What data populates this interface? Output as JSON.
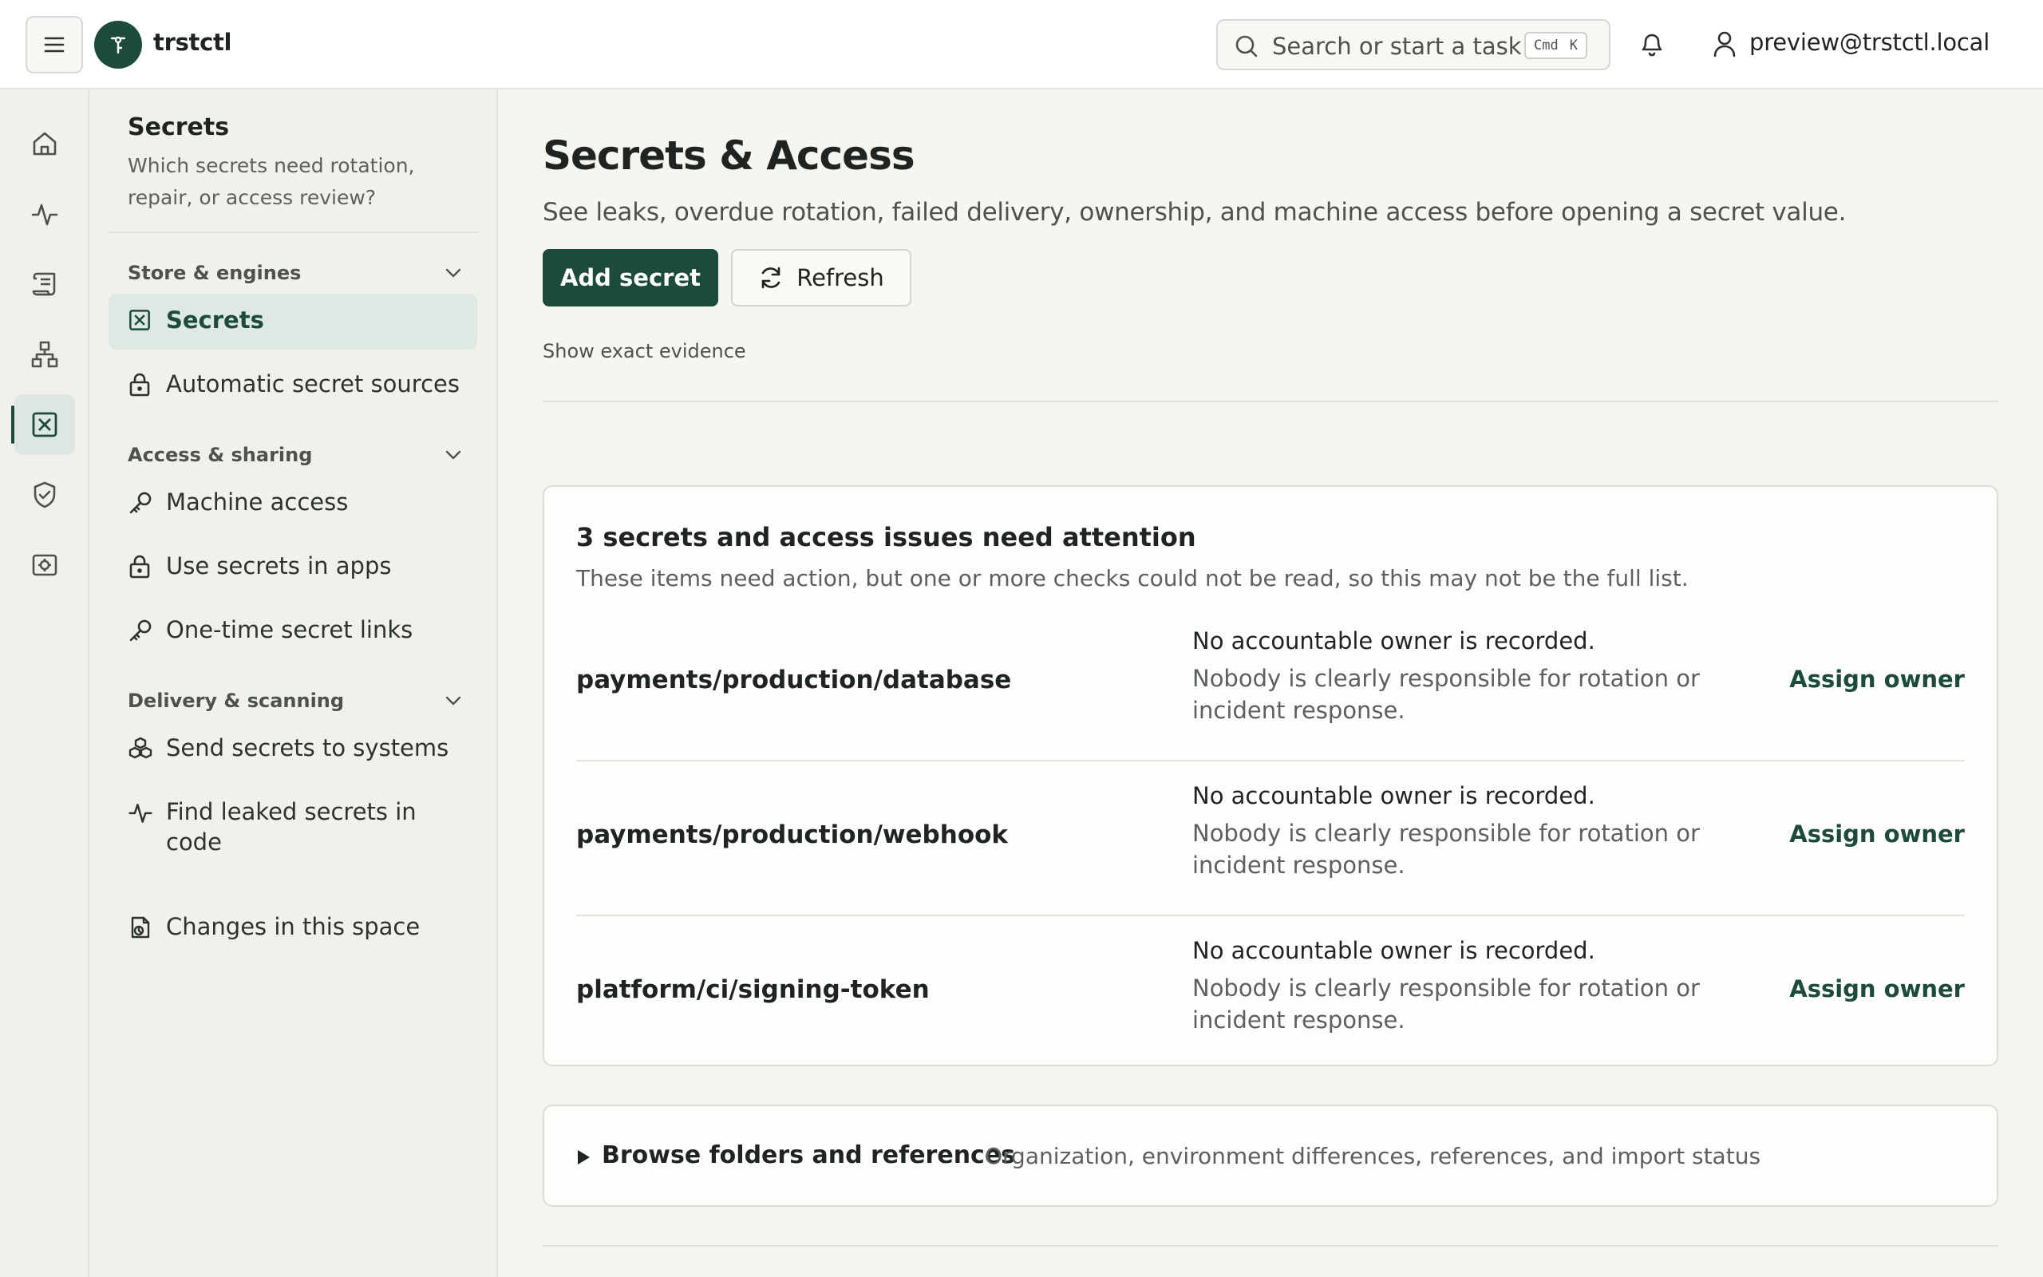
{
  "app": {
    "name": "trstctl"
  },
  "topbar": {
    "search_placeholder": "Search or start a task",
    "shortcut_mod": "Cmd",
    "shortcut_key": "K",
    "user_email": "preview@trstctl.local"
  },
  "rail": {
    "items": [
      {
        "icon": "home-icon"
      },
      {
        "icon": "activity-icon"
      },
      {
        "icon": "scroll-icon"
      },
      {
        "icon": "network-icon"
      },
      {
        "icon": "secret-box-icon",
        "active": true
      },
      {
        "icon": "shield-check-icon"
      },
      {
        "icon": "settings-box-icon"
      }
    ]
  },
  "sidebar": {
    "title": "Secrets",
    "description": "Which secrets need rotation, repair, or access review?",
    "groups": [
      {
        "label": "Store & engines",
        "items": [
          {
            "label": "Secrets",
            "icon": "secret-box-icon",
            "active": true
          },
          {
            "label": "Automatic secret sources",
            "icon": "lock-icon"
          }
        ]
      },
      {
        "label": "Access & sharing",
        "items": [
          {
            "label": "Machine access",
            "icon": "key-icon"
          },
          {
            "label": "Use secrets in apps",
            "icon": "lock-icon"
          },
          {
            "label": "One-time secret links",
            "icon": "key-icon"
          }
        ]
      },
      {
        "label": "Delivery & scanning",
        "items": [
          {
            "label": "Send secrets to systems",
            "icon": "cubes-icon"
          },
          {
            "label": "Find leaked secrets in code",
            "icon": "activity-icon"
          }
        ]
      }
    ],
    "footer_item": {
      "label": "Changes in this space",
      "icon": "history-icon"
    }
  },
  "main": {
    "title": "Secrets & Access",
    "subtitle": "See leaks, overdue rotation, failed delivery, ownership, and machine access before opening a secret value.",
    "add_button": "Add secret",
    "refresh_button": "Refresh",
    "evidence_link": "Show exact evidence"
  },
  "attention": {
    "title": "3 secrets and access issues need attention",
    "description": "These items need action, but one or more checks could not be read, so this may not be the full list.",
    "issues": [
      {
        "name": "payments/production/database",
        "headline": "No accountable owner is recorded.",
        "detail": "Nobody is clearly responsible for rotation or incident response.",
        "action": "Assign owner"
      },
      {
        "name": "payments/production/webhook",
        "headline": "No accountable owner is recorded.",
        "detail": "Nobody is clearly responsible for rotation or incident response.",
        "action": "Assign owner"
      },
      {
        "name": "platform/ci/signing-token",
        "headline": "No accountable owner is recorded.",
        "detail": "Nobody is clearly responsible for rotation or incident response.",
        "action": "Assign owner"
      }
    ]
  },
  "browse": {
    "title": "Browse folders and references",
    "description": "Organization, environment differences, references, and import status"
  },
  "colors": {
    "accent": "#1c4a3c",
    "active_nav_bg": "#dde9e2",
    "page_bg": "#f5f5f1"
  }
}
